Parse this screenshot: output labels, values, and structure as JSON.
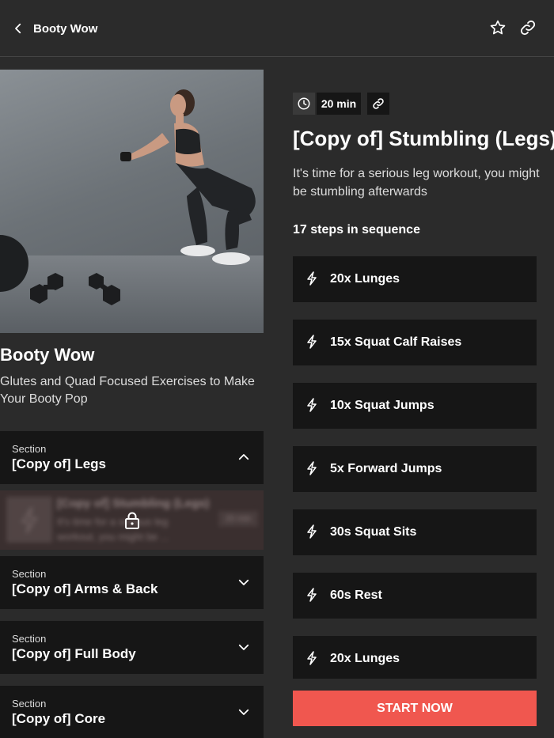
{
  "header": {
    "back_label": "Booty Wow"
  },
  "program": {
    "title": "Booty Wow",
    "description": "Glutes and Quad Focused Exercises to Make Your Booty Pop"
  },
  "sections": [
    {
      "label": "Section",
      "title": "[Copy of] Legs",
      "expanded": true
    },
    {
      "label": "Section",
      "title": "[Copy of] Arms & Back",
      "expanded": false
    },
    {
      "label": "Section",
      "title": "[Copy of] Full Body",
      "expanded": false
    },
    {
      "label": "Section",
      "title": "[Copy of] Core",
      "expanded": false
    }
  ],
  "locked_workout": {
    "title": "[Copy of] Stumbling (Legs)",
    "description": "It's time for a serious leg workout, you might be ...",
    "duration": "20 min"
  },
  "workout": {
    "duration": "20 min",
    "title": "[Copy of] Stumbling (Legs)",
    "description": "It's time for a serious leg workout, you might be stumbling afterwards",
    "steps_heading": "17 steps in sequence",
    "steps": [
      "20x Lunges",
      "15x Squat Calf Raises",
      "10x Squat Jumps",
      "5x Forward Jumps",
      "30s Squat Sits",
      "60s Rest",
      "20x Lunges"
    ],
    "start_label": "START NOW"
  },
  "colors": {
    "accent": "#f0574f",
    "background": "#2b2b2b",
    "card": "#161616"
  },
  "icons": {
    "back": "chevron-left-icon",
    "favorite": "star-icon",
    "share": "link-icon",
    "clock": "clock-icon",
    "step": "lightning-icon",
    "collapse": "chevron-up-icon",
    "expand": "chevron-down-icon",
    "lock": "lock-icon"
  }
}
